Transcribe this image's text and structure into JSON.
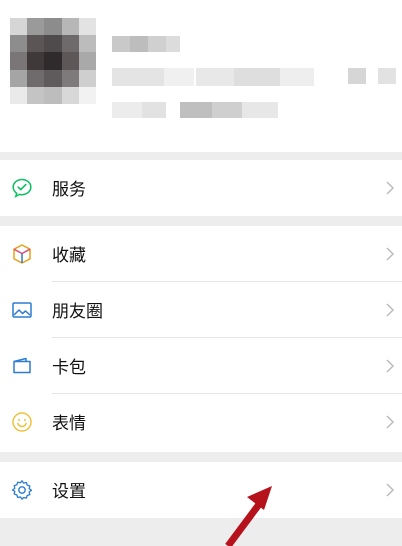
{
  "profile": {
    "avatar_label": "avatar (pixelated)",
    "name_label": "name (pixelated)",
    "id_label": "wechat id (pixelated)",
    "status_label": "status (pixelated)"
  },
  "menu": {
    "group1": [
      {
        "label": "服务",
        "icon": "service-check-icon",
        "color": "#07c160"
      }
    ],
    "group2": [
      {
        "label": "收藏",
        "icon": "favorites-cube-icon",
        "color": "#e8a317"
      },
      {
        "label": "朋友圈",
        "icon": "moments-picture-icon",
        "color": "#2d7bd2"
      },
      {
        "label": "卡包",
        "icon": "card-wallet-icon",
        "color": "#2d7bd2"
      },
      {
        "label": "表情",
        "icon": "sticker-smile-icon",
        "color": "#f0c23b"
      }
    ],
    "group3": [
      {
        "label": "设置",
        "icon": "settings-gear-icon",
        "color": "#2d7bd2"
      }
    ]
  },
  "colors": {
    "background": "#ededed",
    "panel": "#ffffff",
    "text": "#111111",
    "chevron": "#b8b8b8",
    "annotation_arrow": "#b5121b"
  }
}
